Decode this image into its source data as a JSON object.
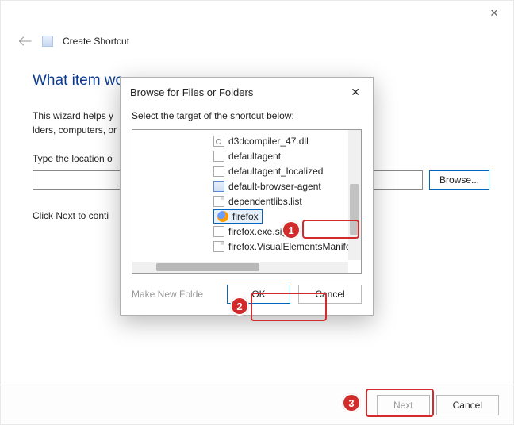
{
  "window": {
    "header_title": "Create Shortcut",
    "heading": "What item wo",
    "wizard_text_pre": "This wizard helps y",
    "wizard_text_post": "lders, computers, or Internet addres",
    "location_label": "Type the location o",
    "browse_label": "Browse...",
    "continue_text": "Click Next to conti",
    "next_label": "Next",
    "cancel_label": "Cancel"
  },
  "modal": {
    "title": "Browse for Files or Folders",
    "prompt": "Select the target of the shortcut below:",
    "make_folder_label": "Make New Folde",
    "ok_label": "OK",
    "cancel_label": "Cancel",
    "files": [
      {
        "name": "d3dcompiler_47.dll",
        "icon": "dll",
        "selected": false
      },
      {
        "name": "defaultagent",
        "icon": "blank",
        "selected": false
      },
      {
        "name": "defaultagent_localized",
        "icon": "blank",
        "selected": false
      },
      {
        "name": "default-browser-agent",
        "icon": "app",
        "selected": false
      },
      {
        "name": "dependentlibs.list",
        "icon": "sheet",
        "selected": false
      },
      {
        "name": "firefox",
        "icon": "ff",
        "selected": true
      },
      {
        "name": "firefox.exe.sig",
        "icon": "blank",
        "selected": false
      },
      {
        "name": "firefox.VisualElementsManifest",
        "icon": "sheet",
        "selected": false
      }
    ]
  },
  "annotations": {
    "b1": "1",
    "b2": "2",
    "b3": "3"
  }
}
